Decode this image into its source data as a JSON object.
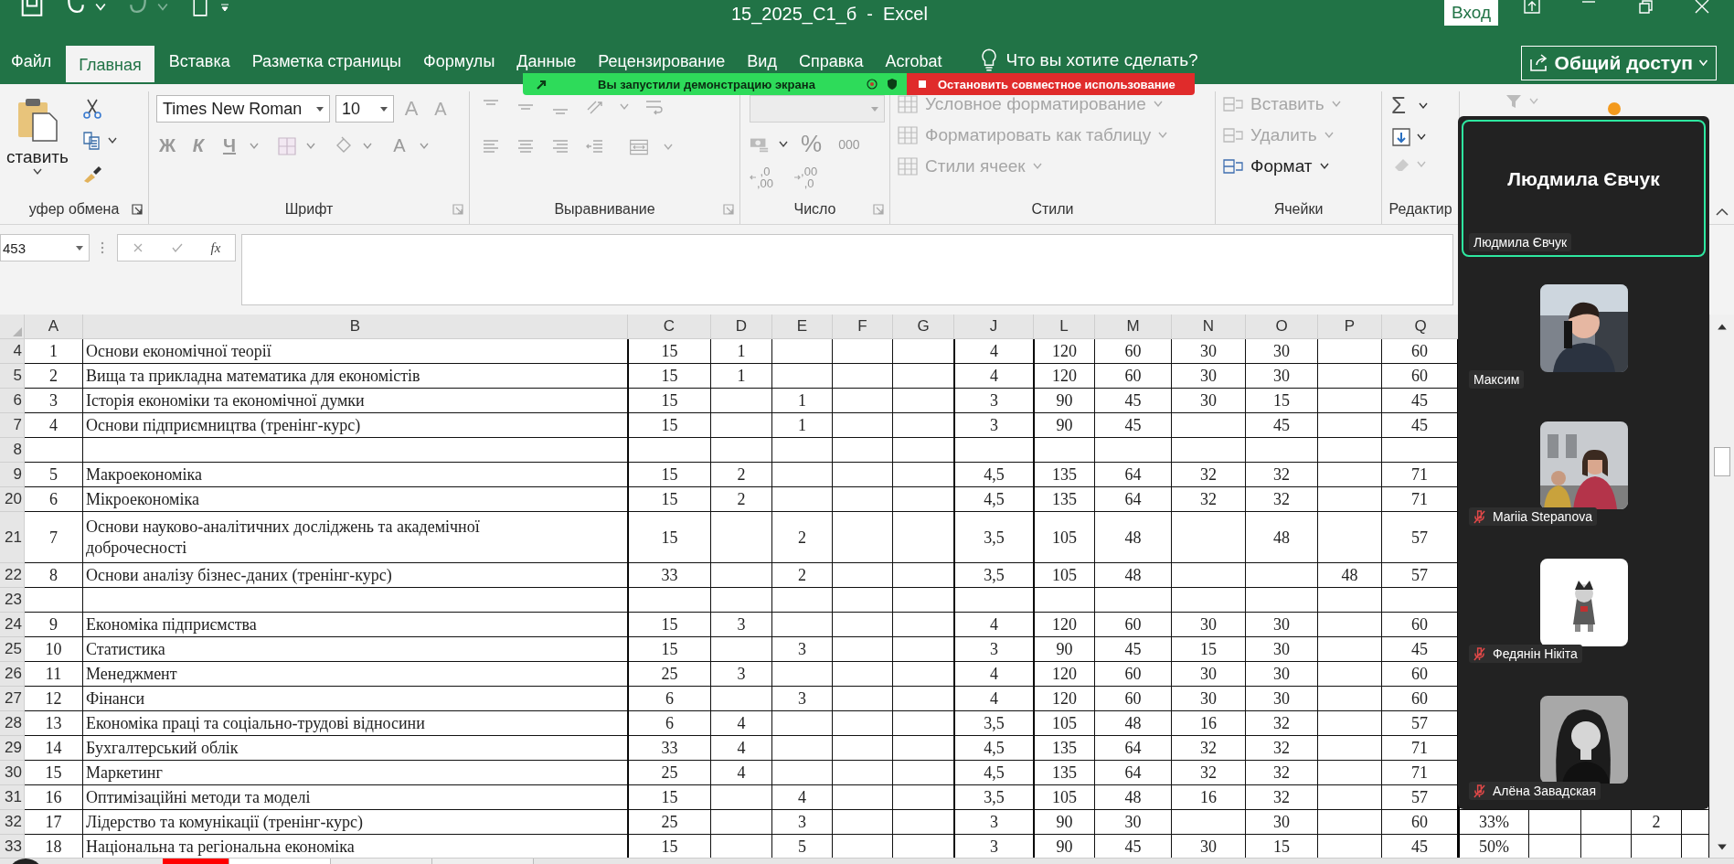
{
  "title_bar": {
    "title": "15_2025_С1_б  -  Excel",
    "sign_in": "Вход"
  },
  "tabs": [
    {
      "label": "Файл",
      "selected": false
    },
    {
      "label": "Главная",
      "selected": true
    },
    {
      "label": "Вставка",
      "selected": false
    },
    {
      "label": "Разметка страницы",
      "selected": false
    },
    {
      "label": "Формулы",
      "selected": false
    },
    {
      "label": "Данные",
      "selected": false
    },
    {
      "label": "Рецензирование",
      "selected": false
    },
    {
      "label": "Вид",
      "selected": false
    },
    {
      "label": "Справка",
      "selected": false
    },
    {
      "label": "Acrobat",
      "selected": false
    }
  ],
  "tell_me": "Что вы хотите сделать?",
  "share_button": "Общий доступ",
  "screen_share_banner": {
    "sharing": "Вы запустили демонстрацию экрана",
    "stop": "Остановить совместное использование"
  },
  "ribbon": {
    "clipboard": {
      "label": "уфер обмена",
      "paste": "ставить"
    },
    "font": {
      "label": "Шрифт",
      "font_name": "Times New Roman",
      "font_size": "10",
      "grow": "A",
      "shrink": "A",
      "bold": "Ж",
      "italic": "К",
      "underline": "Ч",
      "font_color": "A"
    },
    "alignment": {
      "label": "Выравнивание"
    },
    "number": {
      "label": "Число",
      "percent": "%",
      "thousands": "000",
      "increase_decimal": [
        ",0",
        ",00"
      ],
      "decrease_decimal": [
        ",00",
        ",0"
      ]
    },
    "styles": {
      "label": "Стили",
      "items": [
        {
          "label": "Условное форматирование",
          "disabled": true
        },
        {
          "label": "Форматировать как таблицу",
          "disabled": true
        },
        {
          "label": "Стили ячеек",
          "disabled": true
        }
      ]
    },
    "cells": {
      "label": "Ячейки",
      "items": [
        {
          "label": "Вставить",
          "disabled": true
        },
        {
          "label": "Удалить",
          "disabled": true
        },
        {
          "label": "Формат",
          "disabled": false
        }
      ]
    },
    "editing": {
      "label": "Редактир",
      "sum": "Σ"
    }
  },
  "formula_bar": {
    "name_box": "453",
    "function_label": "fx"
  },
  "sheet": {
    "columns": [
      "A",
      "B",
      "C",
      "D",
      "E",
      "F",
      "G",
      "J",
      "L",
      "M",
      "N",
      "O",
      "P",
      "Q"
    ],
    "rows": [
      {
        "number": "4",
        "cells": [
          "1",
          "Основи економічної теорії",
          "15",
          "1",
          null,
          null,
          null,
          "4",
          "120",
          "60",
          "30",
          "30",
          null,
          "60"
        ]
      },
      {
        "number": "5",
        "cells": [
          "2",
          "Вища та прикладна математика для економістів",
          "15",
          "1",
          null,
          null,
          null,
          "4",
          "120",
          "60",
          "30",
          "30",
          null,
          "60"
        ]
      },
      {
        "number": "6",
        "cells": [
          "3",
          "Історія економіки  та економічної думки",
          "15",
          null,
          "1",
          null,
          null,
          "3",
          "90",
          "45",
          "30",
          "15",
          null,
          "45"
        ]
      },
      {
        "number": "7",
        "cells": [
          "4",
          "Основи підприємництва (тренінг-курс)",
          "15",
          null,
          "1",
          null,
          null,
          "3",
          "90",
          "45",
          null,
          "45",
          null,
          "45"
        ]
      },
      {
        "number": "8",
        "cells": [
          null,
          null,
          null,
          null,
          null,
          null,
          null,
          null,
          null,
          null,
          null,
          null,
          null,
          null
        ]
      },
      {
        "number": "9",
        "cells": [
          "5",
          "Макроекономіка",
          "15",
          "2",
          null,
          null,
          null,
          "4,5",
          "135",
          "64",
          "32",
          "32",
          null,
          "71"
        ]
      },
      {
        "number": "20",
        "cells": [
          "6",
          "Мікроекономіка",
          "15",
          "2",
          null,
          null,
          null,
          "4,5",
          "135",
          "64",
          "32",
          "32",
          null,
          "71"
        ]
      },
      {
        "number": "21",
        "cells": [
          "7",
          " Основи науково-аналітичних досліджень та академічної доброчесності",
          "15",
          null,
          "2",
          null,
          null,
          "3,5",
          "105",
          "48",
          null,
          "48",
          null,
          "57"
        ]
      },
      {
        "number": "22",
        "cells": [
          "8",
          "Основи аналізу бізнес-даних (тренінг-курс)",
          "33",
          null,
          "2",
          null,
          null,
          "3,5",
          "105",
          "48",
          null,
          null,
          "48",
          "57"
        ]
      },
      {
        "number": "23",
        "cells": [
          null,
          null,
          null,
          null,
          null,
          null,
          null,
          null,
          null,
          null,
          null,
          null,
          null,
          null
        ]
      },
      {
        "number": "24",
        "cells": [
          "9",
          "Економіка підприємства",
          "15",
          "3",
          null,
          null,
          null,
          "4",
          "120",
          "60",
          "30",
          "30",
          null,
          "60"
        ]
      },
      {
        "number": "25",
        "cells": [
          "10",
          "Статистика",
          "15",
          null,
          "3",
          null,
          null,
          "3",
          "90",
          "45",
          "15",
          "30",
          null,
          "45"
        ]
      },
      {
        "number": "26",
        "cells": [
          "11",
          "Менеджмент",
          "25",
          "3",
          null,
          null,
          null,
          "4",
          "120",
          "60",
          "30",
          "30",
          null,
          "60"
        ]
      },
      {
        "number": "27",
        "cells": [
          "12",
          "Фінанси",
          "6",
          null,
          "3",
          null,
          null,
          "4",
          "120",
          "60",
          "30",
          "30",
          null,
          "60"
        ]
      },
      {
        "number": "28",
        "cells": [
          "13",
          "Економіка праці та соціально-трудові відносини",
          "6",
          "4",
          null,
          null,
          null,
          "3,5",
          "105",
          "48",
          "16",
          "32",
          null,
          "57"
        ]
      },
      {
        "number": "29",
        "cells": [
          "14",
          "Бухгалтерський облік",
          "33",
          "4",
          null,
          null,
          null,
          "4,5",
          "135",
          "64",
          "32",
          "32",
          null,
          "71"
        ]
      },
      {
        "number": "30",
        "cells": [
          "15",
          "Маркетинг",
          "25",
          "4",
          null,
          null,
          null,
          "4,5",
          "135",
          "64",
          "32",
          "32",
          null,
          "71"
        ]
      },
      {
        "number": "31",
        "cells": [
          "16",
          "Оптимізаційні методи та моделі",
          "15",
          null,
          "4",
          null,
          null,
          "3,5",
          "105",
          "48",
          "16",
          "32",
          null,
          "57"
        ]
      },
      {
        "number": "32",
        "cells": [
          "17",
          "Лідерство та комунікації (тренінг-курс)",
          "25",
          null,
          "3",
          null,
          null,
          "3",
          "90",
          "30",
          null,
          "30",
          null,
          "60"
        ],
        "extra_cells": [
          "33%",
          null,
          null,
          "2",
          null
        ]
      },
      {
        "number": "33",
        "cells": [
          "18",
          "Національна та регіональна економіка",
          "15",
          null,
          "5",
          null,
          null,
          "3",
          "90",
          "45",
          "30",
          "15",
          null,
          "45"
        ],
        "extra_cells": [
          "50%",
          null,
          null,
          null,
          null
        ]
      }
    ]
  },
  "participants": [
    {
      "title": "Людмила Євчук",
      "name": "Людмила Євчук",
      "kind": "name",
      "selected": true,
      "muted": false
    },
    {
      "name": "Максим",
      "kind": "picture",
      "selected": false,
      "muted": false
    },
    {
      "name": "Mariia Stepanova",
      "kind": "picture",
      "selected": false,
      "muted": true
    },
    {
      "name": "Федянін Нікіта",
      "kind": "picture",
      "selected": false,
      "muted": true
    },
    {
      "name": "Алёна Завадская",
      "kind": "picture",
      "selected": false,
      "muted": true
    }
  ]
}
